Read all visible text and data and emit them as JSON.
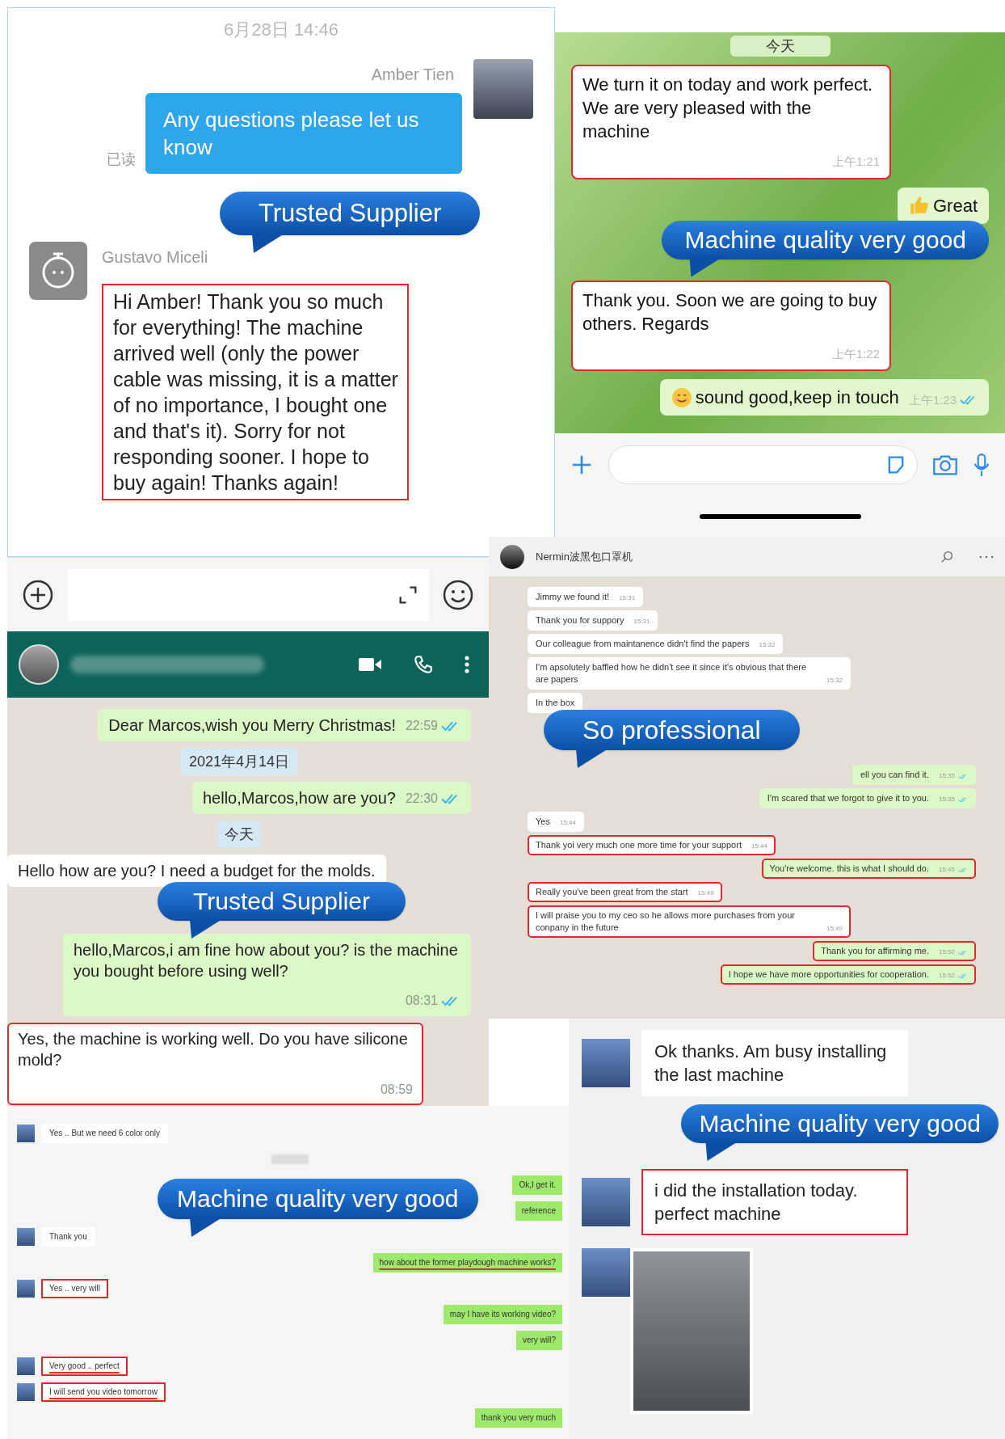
{
  "wechat_chat": {
    "date": "6月28日 14:46",
    "messages": [
      {
        "kind": "outgoing",
        "sender": "Amber Tien",
        "text": "Any questions please let us know",
        "status": "已读",
        "highlighted": false
      },
      {
        "kind": "badge",
        "text": "Trusted Supplier"
      },
      {
        "kind": "incoming",
        "sender": "Gustavo Miceli",
        "text": "Hi Amber! Thank you so much for everything! The machine arrived well (only the power cable was missing, it is a matter of no importance, I bought one and that's it). Sorry for not responding sooner. I hope to buy again! Thanks again!",
        "highlighted": true
      }
    ]
  },
  "whatsapp_top": {
    "messages": [
      {
        "kind": "date",
        "text": "今天"
      },
      {
        "kind": "incoming",
        "text": "We turn it on today and work perfect.  We are very pleased with the machine",
        "time": "上午1:21",
        "highlighted": true
      },
      {
        "kind": "thumbsup",
        "text": "Great",
        "highlighted": false
      },
      {
        "kind": "badge",
        "text": "Machine quality very good"
      },
      {
        "kind": "incoming",
        "text": "Thank you. Soon we are going to buy  others. Regards",
        "time": "上午1:22",
        "highlighted": true
      },
      {
        "kind": "smiley",
        "text": "sound good,keep in touch",
        "time": "上午1:23",
        "read": true,
        "highlighted": false
      }
    ]
  },
  "whatsapp_marcos": {
    "messages": [
      {
        "kind": "outgoing",
        "text": "Dear Marcos,wish you Merry Christmas!",
        "time": "22:59",
        "read": true,
        "highlighted": false
      },
      {
        "kind": "date",
        "text": "2021年4月14日"
      },
      {
        "kind": "outgoing",
        "text": "hello,Marcos,how are you?",
        "time": "22:30",
        "read": true,
        "highlighted": false
      },
      {
        "kind": "date",
        "text": "今天"
      },
      {
        "kind": "incoming",
        "text": "Hello how are you?  I need a budget for the molds.",
        "highlighted": false
      },
      {
        "kind": "badge",
        "text": "Trusted Supplier"
      },
      {
        "kind": "outgoing",
        "text": "hello,Marcos,i am fine how about you? is the machine you bought before using well?",
        "time": "08:31",
        "read": true,
        "highlighted": false
      },
      {
        "kind": "incoming",
        "text": "Yes, the machine is working well.  Do you have silicone mold?",
        "time": "08:59",
        "highlighted": true
      }
    ]
  },
  "nermin_chat": {
    "contact": "Nermin波黑包口罩机",
    "messages": [
      {
        "kind": "incoming",
        "text": "Jimmy we found it!",
        "time": "15:31",
        "highlighted": false
      },
      {
        "kind": "incoming",
        "text": "Thank you for suppory",
        "time": "15:31",
        "highlighted": false
      },
      {
        "kind": "incoming",
        "text": "Our colleague from maintanence didn't find the papers",
        "time": "15:32",
        "highlighted": false
      },
      {
        "kind": "incoming",
        "text": "I'm apsolutely baffled how he didn't see it since it's obvious that there are papers",
        "time": "15:32",
        "highlighted": false
      },
      {
        "kind": "incoming",
        "text": "In the box",
        "highlighted": false
      },
      {
        "kind": "badge",
        "text": "So professional"
      },
      {
        "kind": "outgoing",
        "text": "ell you can find it.",
        "time": "15:35",
        "read": true,
        "highlighted": false
      },
      {
        "kind": "outgoing",
        "text": "I'm scared that we forgot to give it to you.",
        "time": "15:35",
        "read": true,
        "highlighted": false
      },
      {
        "kind": "incoming",
        "text": "Yes",
        "time": "15:44",
        "highlighted": false
      },
      {
        "kind": "incoming",
        "text": "Thank yoi very much one more time for your support",
        "time": "15:44",
        "highlighted": true
      },
      {
        "kind": "outgoing",
        "text": "You're welcome. this is what I should do.",
        "time": "15:45",
        "read": true,
        "highlighted": true
      },
      {
        "kind": "incoming",
        "text": "Really you've been great from the start",
        "time": "15:49",
        "highlighted": true
      },
      {
        "kind": "incoming",
        "text": "I will praise you to my ceo so he allows more purchases from your conpany in the future",
        "time": "15:49",
        "highlighted": true
      },
      {
        "kind": "outgoing",
        "text": "Thank you for affirming me.",
        "time": "15:52",
        "read": true,
        "highlighted": true
      },
      {
        "kind": "outgoing",
        "text": "I hope we have more opportunities for cooperation.",
        "time": "15:52",
        "read": true,
        "highlighted": true
      }
    ]
  },
  "pc_chat": {
    "badge": "Machine quality very good",
    "messages": [
      {
        "kind": "incoming",
        "text": "Yes .. But we need 6 color only",
        "underlined": false,
        "highlighted": false
      },
      {
        "kind": "blurred_date"
      },
      {
        "kind": "outgoing",
        "text": "Ok,I get it.",
        "underlined": false,
        "highlighted": false
      },
      {
        "kind": "outgoing",
        "text": "reference",
        "underlined": false,
        "highlighted": false
      },
      {
        "kind": "incoming",
        "text": "Thank you",
        "underlined": false,
        "highlighted": false
      },
      {
        "kind": "outgoing",
        "text": "how about the former playdough machine works?",
        "underlined": true,
        "highlighted": false
      },
      {
        "kind": "incoming",
        "text": "Yes ..  very will",
        "underlined": false,
        "highlighted": true
      },
      {
        "kind": "outgoing",
        "text": "may I have its working video?",
        "underlined": false,
        "highlighted": false
      },
      {
        "kind": "outgoing",
        "text": "very will?",
        "underlined": false,
        "highlighted": false
      },
      {
        "kind": "incoming",
        "text": "Very good .. perfect",
        "underlined": true,
        "highlighted": true
      },
      {
        "kind": "incoming",
        "text": "I will send you video tomorrow",
        "underlined": true,
        "highlighted": true
      },
      {
        "kind": "outgoing",
        "text": "thank you very much",
        "underlined": false,
        "highlighted": false
      }
    ]
  },
  "mobile_chat": {
    "messages": [
      {
        "kind": "incoming",
        "text": "Ok thanks.  Am busy installing the last machine",
        "highlighted": false
      },
      {
        "kind": "badge",
        "text": "Machine quality very good"
      },
      {
        "kind": "incoming",
        "text": "i did the installation today. perfect machine",
        "highlighted": true
      },
      {
        "kind": "photo"
      }
    ]
  }
}
